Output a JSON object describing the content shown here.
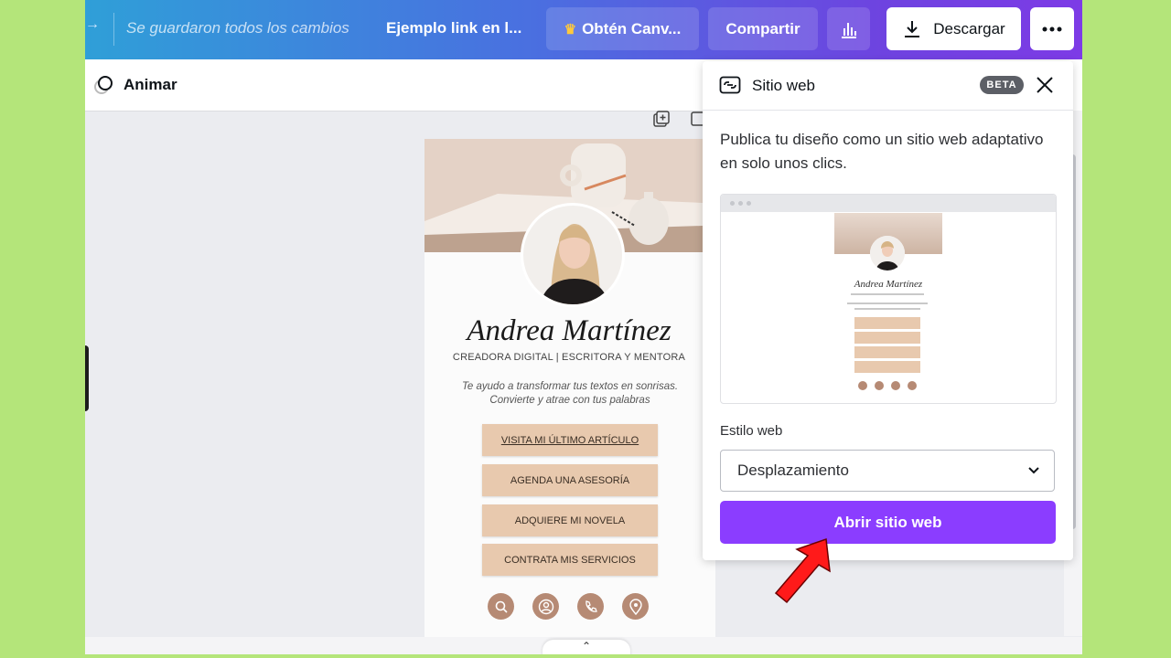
{
  "topbar": {
    "saved_status": "Se guardaron todos los cambios",
    "doc_title": "Ejemplo link en l...",
    "pro_button": "Obtén Canv...",
    "share_button": "Compartir",
    "download_button": "Descargar"
  },
  "toolbar": {
    "animate_label": "Animar"
  },
  "design": {
    "name": "Andrea Martínez",
    "role": "CREADORA DIGITAL | ESCRITORA Y MENTORA",
    "bio_line1": "Te ayudo a transformar tus textos en sonrisas.",
    "bio_line2": "Convierte y atrae con tus palabras",
    "buttons": [
      "VISITA MI ÚLTIMO ARTÍCULO",
      "AGENDA UNA ASESORÍA",
      "ADQUIERE MI NOVELA",
      "CONTRATA MIS SERVICIOS"
    ],
    "socials": [
      "search-icon",
      "user-icon",
      "phone-icon",
      "location-icon"
    ]
  },
  "panel": {
    "title": "Sitio web",
    "badge": "BETA",
    "description": "Publica tu diseño como un sitio web adaptativo en solo unos clics.",
    "preview_name": "Andrea Martínez",
    "style_label": "Estilo web",
    "style_value": "Desplazamiento",
    "open_button": "Abrir sitio web"
  },
  "colors": {
    "brand_purple": "#8b3dff",
    "link_button": "#e8c9ae",
    "social_icon": "#b68a74",
    "annotation_arrow": "#ff1a1a",
    "background_frame": "#b4e57a"
  }
}
